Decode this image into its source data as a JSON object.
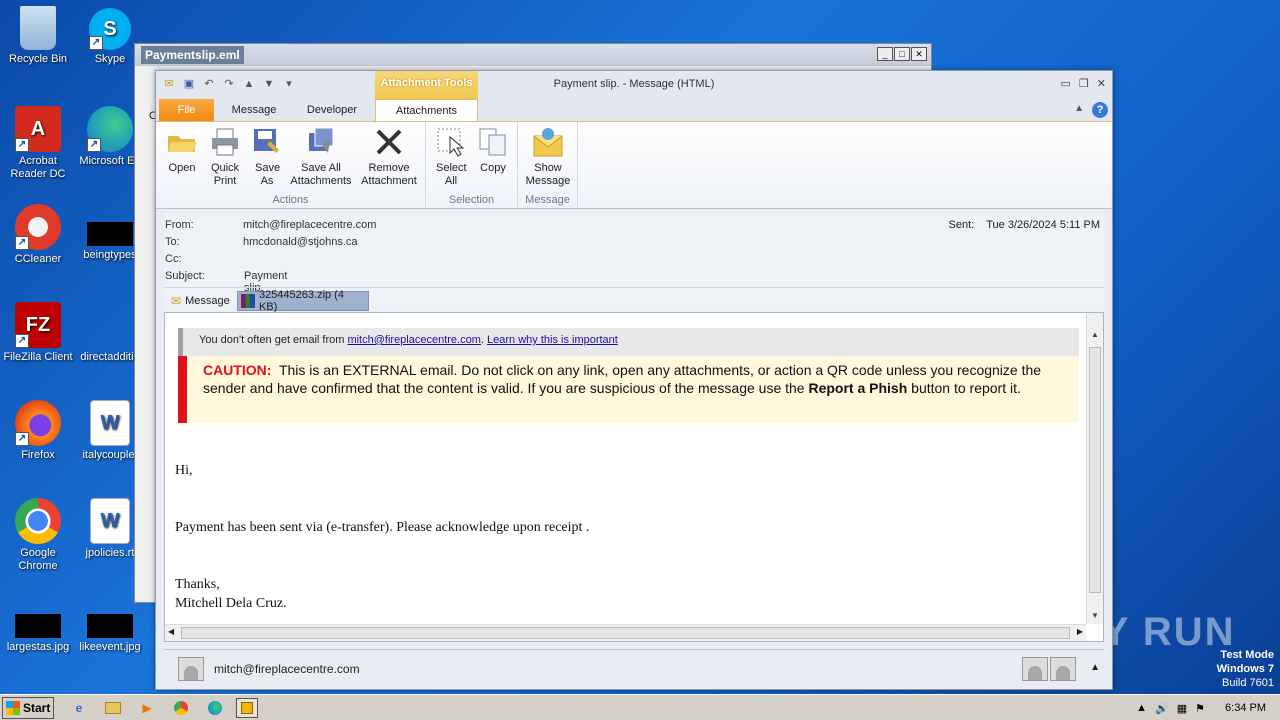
{
  "desktop": {
    "icons": [
      {
        "name": "recycle-bin",
        "label": "Recycle Bin"
      },
      {
        "name": "skype",
        "label": "Skype"
      },
      {
        "name": "acrobat",
        "label": "Acrobat Reader DC"
      },
      {
        "name": "edge",
        "label": "Microsoft Ed"
      },
      {
        "name": "ccleaner",
        "label": "CCleaner"
      },
      {
        "name": "beingtypes",
        "label": "beingtypes"
      },
      {
        "name": "filezilla",
        "label": "FileZilla Client"
      },
      {
        "name": "directaddition",
        "label": "directadditio"
      },
      {
        "name": "firefox",
        "label": "Firefox"
      },
      {
        "name": "italycouple",
        "label": "italycouple."
      },
      {
        "name": "chrome",
        "label": "Google Chrome"
      },
      {
        "name": "jpolicies",
        "label": "jpolicies.rt"
      },
      {
        "name": "largestas",
        "label": "largestas.jpg"
      },
      {
        "name": "likeevent",
        "label": "likeevent.jpg"
      }
    ]
  },
  "background_window": {
    "title": "Paymentslip.eml",
    "partial_letter": "C"
  },
  "window": {
    "context_tab": "Attachment Tools",
    "title": "Payment slip.  -  Message (HTML)"
  },
  "tabs": {
    "file": "File",
    "message": "Message",
    "developer": "Developer",
    "attachments": "Attachments",
    "help": "?"
  },
  "ribbon": {
    "open": "Open",
    "quick_print": "Quick Print",
    "save_as": "Save As",
    "save_all": "Save All Attachments",
    "remove": "Remove Attachment",
    "select_all": "Select All",
    "copy": "Copy",
    "show_message": "Show Message",
    "groups": {
      "actions": "Actions",
      "selection": "Selection",
      "message": "Message"
    }
  },
  "header": {
    "from_label": "From:",
    "from": "mitch@fireplacecentre.com",
    "to_label": "To:",
    "to": "hmcdonald@stjohns.ca",
    "cc_label": "Cc:",
    "subject_label": "Subject:",
    "subject": "Payment slip.",
    "sent_label": "Sent:",
    "sent": "Tue 3/26/2024 5:11 PM"
  },
  "attachments": {
    "message_item": "Message",
    "file": "325445263.zip (4 KB)"
  },
  "body": {
    "notice_prefix": "You don't often get email from ",
    "notice_link": "mitch@fireplacecentre.com",
    "notice_dot": ". ",
    "notice_learn": "Learn why this is important",
    "caution_label": "CAUTION:",
    "caution_text": "This is an EXTERNAL email.  Do not click on any link, open any attachments, or action a QR code unless you recognize the sender and have confirmed that the content is valid.   If you are suspicious of the message use the ",
    "caution_bold": "Report a Phish",
    "caution_end": " button to report it.",
    "greeting": "Hi,",
    "line1": "Payment has been sent via (e-transfer). Please acknowledge upon receipt .",
    "thanks": "Thanks,",
    "signature": "Mitchell Dela Cruz."
  },
  "footer": {
    "sender": "mitch@fireplacecentre.com"
  },
  "taskbar": {
    "start": "Start",
    "time": "6:34 PM"
  },
  "watermark": "ANY RUN",
  "test_mode": {
    "line1": "Test Mode",
    "line2": "Windows 7",
    "line3": "Build 7601"
  },
  "colors": {
    "caution_red": "#e0111b",
    "file_tab": "#f28a14",
    "context_tab": "#f1c84e",
    "link": "#1a0dab"
  }
}
